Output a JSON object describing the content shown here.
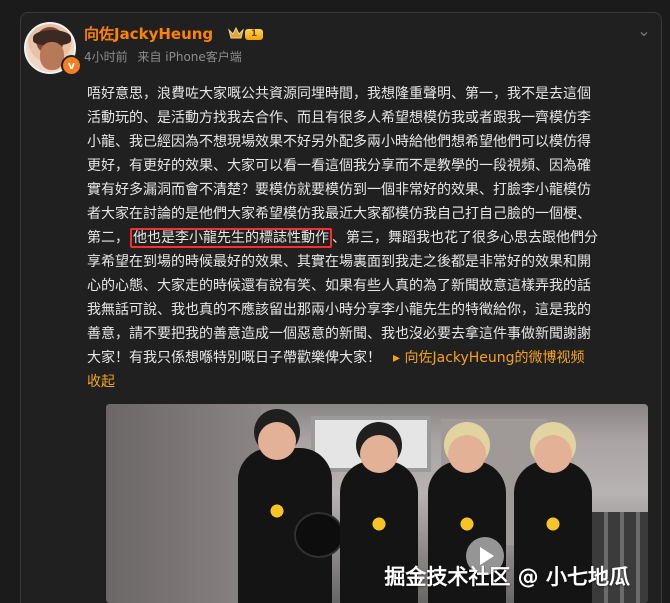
{
  "post": {
    "author": {
      "name": "向佐JackyHeung",
      "level": "1",
      "verified_mark": "v",
      "time": "4小时前",
      "source": "来自 iPhone客户端"
    },
    "content": {
      "lines": [
        "唔好意思，浪費咗大家嘅公共資源同埋時間，我想隆重聲明、第一，我不是去這個",
        "活動玩的、是活動方找我去合作、而且有很多人希望想模仿我或者跟我一齊模仿李",
        "小龍、我已經因為不想現場效果不好另外配多兩小時給他們想希望他們可以模仿得",
        "更好，有更好的效果、大家可以看一看這個我分享而不是教學的一段視頻、因為確",
        "實有好多漏洞而會不清楚？要模仿就要模仿到一個非常好的效果、打臉李小龍模仿",
        "者大家在討論的是他們大家希望模仿我最近大家都模仿我自己打自己臉的一個梗、",
        "第二，",
        "享希望在到場的時候最好的效果、其實在場裏面到我走之後都是非常好的效果和開",
        "心的心態、大家走的時候還有說有笑、如果有些人真的為了新聞故意這樣弄我的話",
        "我無話可說、我也真的不應該留出那兩小時分享李小龍先生的特徵給你，這是我的",
        "善意，請不要把我的善意造成一個惡意的新聞、我也沒必要去拿這件事做新聞謝謝",
        "大家！有我只係想喺特別嘅日子帶歡樂俾大家！"
      ],
      "highlighted_text": "他也是李小龍先生的標誌性動作",
      "after_highlight": "、第三，舞蹈我也花了很多心思去跟他們分",
      "video_link": "向佐JackyHeung的微博视频",
      "collapse": "收起"
    },
    "video": {
      "watermark": "掘金技术社区 @ 小七地瓜"
    }
  }
}
